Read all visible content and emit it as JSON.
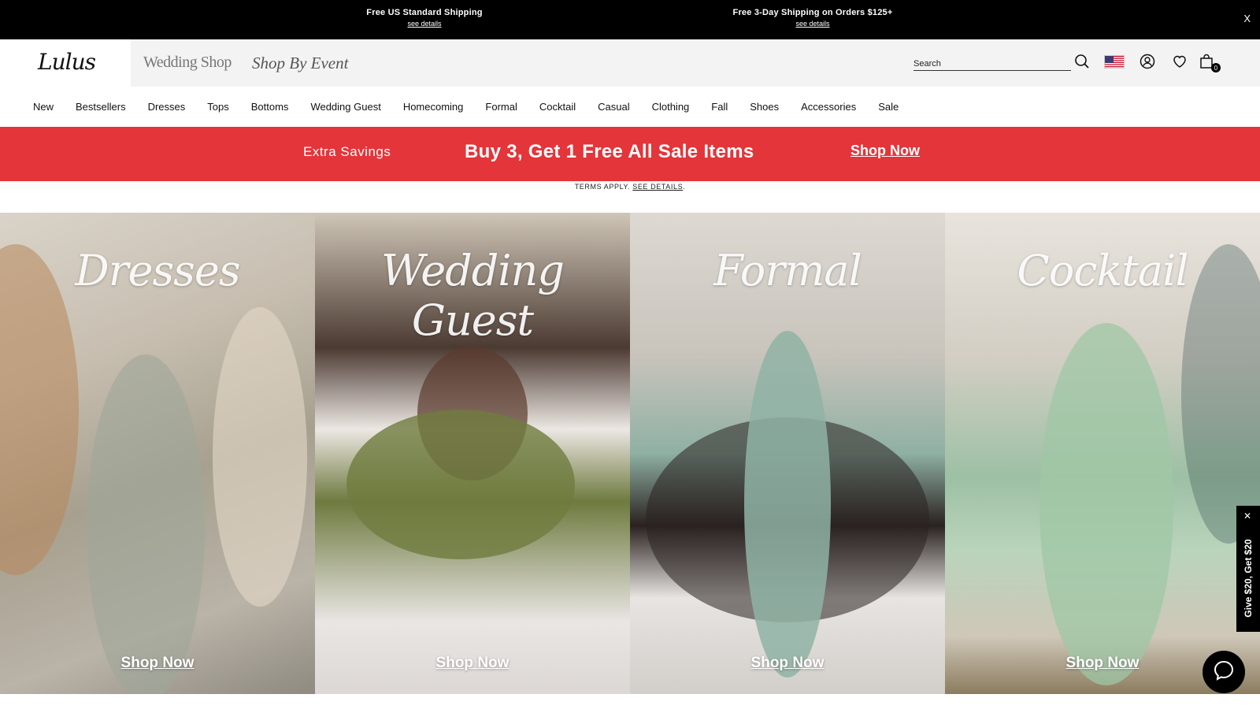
{
  "topbar": {
    "promo1": {
      "title": "Free US Standard Shipping",
      "link": "see details"
    },
    "promo2": {
      "title": "Free 3-Day Shipping on Orders $125+",
      "link": "see details"
    },
    "close": "X"
  },
  "header": {
    "logo": "Lulus",
    "links": [
      "Wedding Shop",
      "Shop By Event"
    ],
    "search_placeholder": "Search",
    "bag_count": "0"
  },
  "nav": {
    "items": [
      "New",
      "Bestsellers",
      "Dresses",
      "Tops",
      "Bottoms",
      "Wedding Guest",
      "Homecoming",
      "Formal",
      "Cocktail",
      "Casual",
      "Clothing",
      "Fall",
      "Shoes",
      "Accessories",
      "Sale"
    ]
  },
  "sale_banner": {
    "eyebrow": "Extra Savings",
    "headline": "Buy 3, Get 1 Free All Sale Items",
    "cta": "Shop Now",
    "terms_prefix": "TERMS APPLY.",
    "terms_link": "SEE DETAILS",
    "terms_suffix": ".",
    "color": "#e3353a"
  },
  "tiles": [
    {
      "title": "Dresses",
      "cta": "Shop Now"
    },
    {
      "title": "Wedding Guest",
      "cta": "Shop Now"
    },
    {
      "title": "Formal",
      "cta": "Shop Now"
    },
    {
      "title": "Cocktail",
      "cta": "Shop Now"
    }
  ],
  "side_promo": {
    "label": "Give $20, Get $20"
  },
  "icons": [
    "search-icon",
    "us-flag-icon",
    "account-icon",
    "heart-icon",
    "bag-icon",
    "chat-icon",
    "close-icon"
  ]
}
